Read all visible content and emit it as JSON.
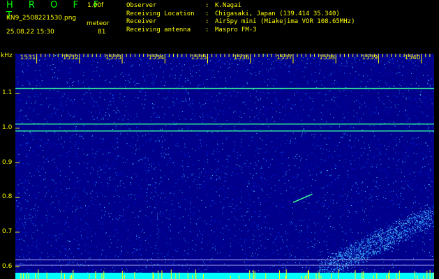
{
  "header": {
    "app_title": "H R O F F T",
    "version": "1.00f",
    "filename": "KN9_2508221530.png",
    "datetime": "25.08.22 15:30",
    "meteor_label": "meteor",
    "meteor_count": "81"
  },
  "info": [
    {
      "key": "Observer",
      "value": "K.Nagai"
    },
    {
      "key": "Receiving Location",
      "value": "Chigasaki, Japan (139.414 35.340)"
    },
    {
      "key": "Receiver",
      "value": "AirSpy mini (Miakejima VOR 108.65MHz)"
    },
    {
      "key": "Receiving antenna",
      "value": "Maspro FM-3"
    }
  ],
  "colors": {
    "background": "#000000",
    "text": "#ffff00",
    "title": "#00ff00",
    "plot_bg": "#00008a",
    "signal": "#33ff99",
    "baseline": "#00ffff"
  },
  "chart_data": {
    "type": "heatmap",
    "title": "",
    "ylabel": "kHz",
    "xlabel": "",
    "x_tick_labels": [
      "1531",
      "1532",
      "1533",
      "1534",
      "1535",
      "1536",
      "1537",
      "1538",
      "1539",
      "1540"
    ],
    "x_ticks": [
      1531,
      1532,
      1533,
      1534,
      1535,
      1536,
      1537,
      1538,
      1539,
      1540
    ],
    "xlim": [
      1530.5,
      1540.3
    ],
    "y_tick_labels": [
      "1.1",
      "1.0",
      "0.9",
      "0.8",
      "0.7",
      "0.6"
    ],
    "y_ticks": [
      1.1,
      1.0,
      0.9,
      0.8,
      0.7,
      0.6
    ],
    "ylim": [
      0.565,
      1.215
    ],
    "grid": false,
    "carriers_khz": [
      1.115,
      1.012,
      0.992
    ],
    "reference_lines_khz": [
      0.62,
      0.605
    ],
    "meteor_echo": {
      "x_start": 1537.0,
      "x_end": 1537.45,
      "y_start": 0.786,
      "y_end": 0.81
    }
  }
}
